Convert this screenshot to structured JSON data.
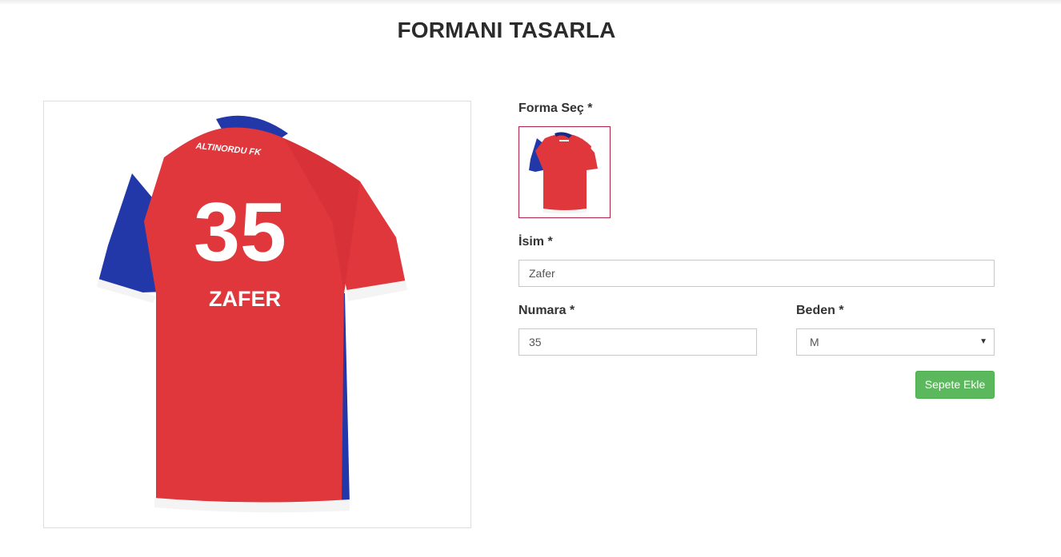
{
  "page": {
    "title": "FORMANI TASARLA"
  },
  "preview": {
    "club_text": "ALTINORDU FK",
    "number": "35",
    "name": "ZAFER"
  },
  "form": {
    "jersey_label": "Forma Seç *",
    "name_label": "İsim *",
    "name_value": "Zafer",
    "number_label": "Numara *",
    "number_value": "35",
    "size_label": "Beden *",
    "size_value": "M",
    "add_to_cart_label": "Sepete Ekle"
  },
  "colors": {
    "jersey_red": "#e0373c",
    "jersey_blue": "#2238a8",
    "selected_border": "#b0224a",
    "button_green": "#5cb85c"
  }
}
